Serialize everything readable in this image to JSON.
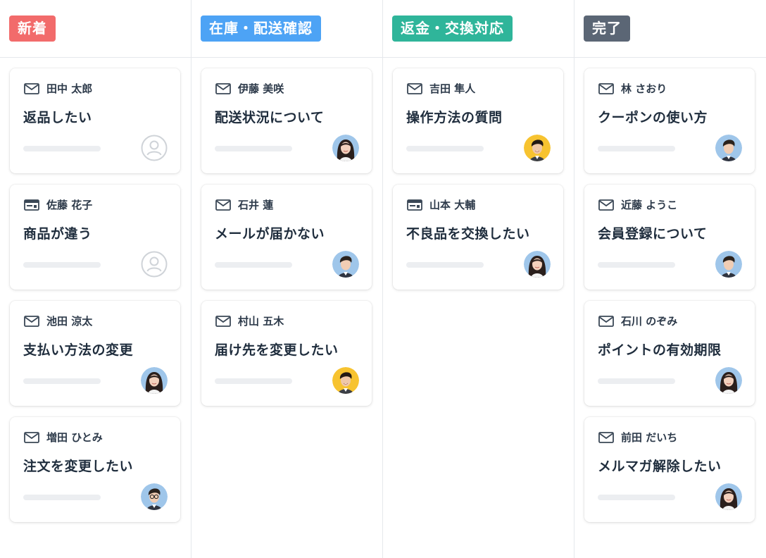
{
  "columns": [
    {
      "label": "新着",
      "color": "#f26b6b",
      "cards": [
        {
          "channel": "mail-icon",
          "customer": "田中 太郎",
          "subject": "返品したい",
          "assignee": "unassigned-user-icon"
        },
        {
          "channel": "chat-window-icon",
          "customer": "佐藤 花子",
          "subject": "商品が違う",
          "assignee": "unassigned-user-icon"
        },
        {
          "channel": "mail-icon",
          "customer": "池田 涼太",
          "subject": "支払い方法の変更",
          "assignee": "female-agent-avatar"
        },
        {
          "channel": "mail-icon",
          "customer": "増田 ひとみ",
          "subject": "注文を変更したい",
          "assignee": "male-agent-glasses-avatar"
        }
      ]
    },
    {
      "label": "在庫・配送確認",
      "color": "#4da3f5",
      "cards": [
        {
          "channel": "mail-icon",
          "customer": "伊藤 美咲",
          "subject": "配送状況について",
          "assignee": "female-agent-avatar"
        },
        {
          "channel": "mail-icon",
          "customer": "石井 蓮",
          "subject": "メールが届かない",
          "assignee": "male-agent-avatar"
        },
        {
          "channel": "mail-icon",
          "customer": "村山 五木",
          "subject": "届け先を変更したい",
          "assignee": "male-agent-yellow-avatar"
        }
      ]
    },
    {
      "label": "返金・交換対応",
      "color": "#2fb59a",
      "cards": [
        {
          "channel": "mail-icon",
          "customer": "吉田 隼人",
          "subject": "操作方法の質問",
          "assignee": "male-agent-yellow-avatar"
        },
        {
          "channel": "chat-window-icon",
          "customer": "山本 大輔",
          "subject": "不良品を交換したい",
          "assignee": "female-agent-avatar"
        }
      ]
    },
    {
      "label": "完了",
      "color": "#5b6675",
      "cards": [
        {
          "channel": "mail-icon",
          "customer": "林 さおり",
          "subject": "クーポンの使い方",
          "assignee": "male-agent-avatar"
        },
        {
          "channel": "mail-icon",
          "customer": "近藤 ようこ",
          "subject": "会員登録について",
          "assignee": "male-agent-avatar"
        },
        {
          "channel": "mail-icon",
          "customer": "石川 のぞみ",
          "subject": "ポイントの有効期限",
          "assignee": "female-agent-avatar"
        },
        {
          "channel": "mail-icon",
          "customer": "前田 だいち",
          "subject": "メルマガ解除したい",
          "assignee": "female-agent-avatar"
        }
      ]
    }
  ]
}
